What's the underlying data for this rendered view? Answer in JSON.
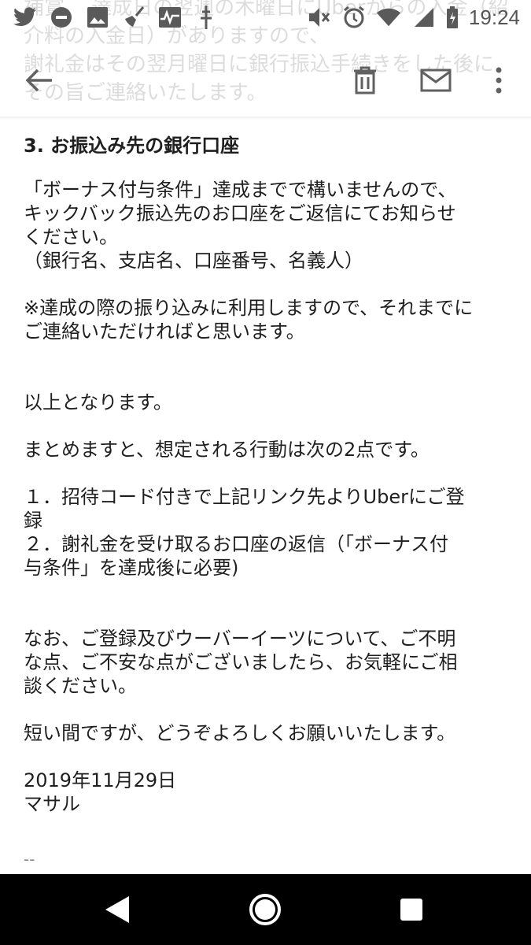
{
  "status_bar": {
    "time": "19:24",
    "left_icons": [
      "twitter-icon",
      "do-not-disturb-icon",
      "image-icon",
      "broom-icon",
      "pulse-icon",
      "usb-icon"
    ],
    "right_icons": [
      "mute-icon",
      "alarm-icon",
      "wifi-icon",
      "signal-icon",
      "battery-icon"
    ]
  },
  "ghost_text": "補賞　 達成日の翌週の木曜日にUberからの入金（紹介料の入金日）がありますので、\n謝礼金はその翌月曜日に銀行振込手続きをした後に\nその旨ご連絡いたします。",
  "toolbar": {
    "back_icon": "arrow-back-icon",
    "delete_icon": "trash-icon",
    "mark_unread_icon": "mail-icon",
    "more_icon": "more-vert-icon"
  },
  "email": {
    "heading": "3.  お振込み先の銀行口座",
    "p1": "「ボーナス付与条件」達成までで構いませんので、\nキックバック振込先のお口座をご返信にてお知らせ\nください。\n（銀行名、支店名、口座番号、名義人）",
    "p2": "※達成の際の振り込みに利用しますので、それまでに\nご連絡いただければと思います。",
    "p3": "以上となります。",
    "p4": "まとめますと、想定される行動は次の2点です。",
    "p5": "１．招待コード付きで上記リンク先よりUberにご登\n録\n２．謝礼金を受け取るお口座の返信（「ボーナス付\n与条件」を達成後に必要)",
    "p6": "なお、ご登録及びウーバーイーツについて、ご不明\nな点、ご不安な点がございましたら、お気軽にご相\n談ください。",
    "p7": "短い間ですが、どうぞよろしくお願いいたします。",
    "date": "2019年11月29日",
    "sender": "マサル",
    "signature_sep": "--"
  },
  "nav_bar": {
    "back_icon": "nav-back-icon",
    "home_icon": "nav-home-icon",
    "recents_icon": "nav-recents-icon"
  }
}
